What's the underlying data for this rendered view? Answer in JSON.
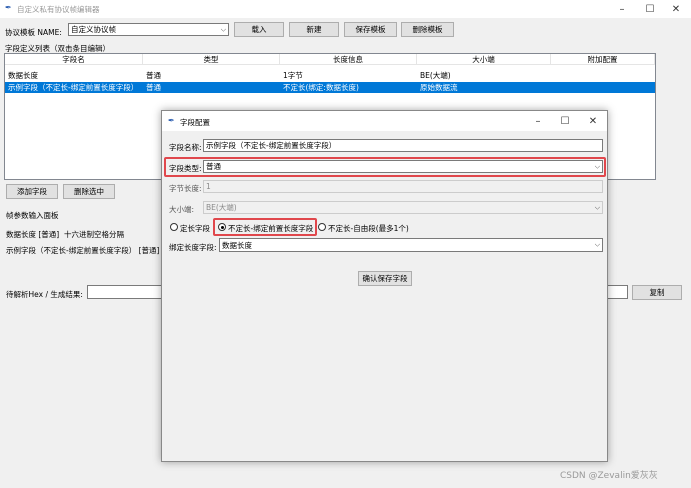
{
  "main": {
    "title": "自定义私有协议帧编辑器",
    "protocol_label": "协议模板 NAME:",
    "protocol_value": "自定义协议帧",
    "buttons": {
      "load": "载入",
      "new": "新建",
      "save": "保存模板",
      "delete": "删除模板"
    },
    "field_list_label": "字段定义列表（双击条目编辑）",
    "table": {
      "headers": [
        "字段名",
        "类型",
        "长度信息",
        "大小端",
        "附加配置"
      ],
      "rows": [
        [
          "数据长度",
          "普通",
          "1字节",
          "BE(大端)",
          ""
        ],
        [
          "示例字段（不定长-绑定前置长度字段）",
          "普通",
          "不定长(绑定:数据长度)",
          "原始数据流",
          ""
        ]
      ]
    },
    "add_field": "添加字段",
    "delete_selected": "删除选中",
    "frame_params_title": "帧参数输入面板",
    "param1_label": "数据长度 [普通]",
    "param1_hint": "十六进制空格分隔",
    "param2_label": "示例字段（不定长-绑定前置长度字段） [普通]",
    "parse_label": "待解析Hex / 生成结果:",
    "copy": "复制"
  },
  "dialog": {
    "title": "字段配置",
    "name_label": "字段名称:",
    "name_value": "示例字段（不定长-绑定前置长度字段）",
    "type_label": "字段类型:",
    "type_value": "普通",
    "byte_len_label": "字节长度:",
    "byte_len_value": "1",
    "endian_label": "大小端:",
    "endian_value": "BE(大端)",
    "radio_fixed": "定长字段",
    "radio_bound": "不定长-绑定前置长度字段",
    "radio_free": "不定长-自由段(最多1个)",
    "bind_label": "绑定长度字段:",
    "bind_value": "数据长度",
    "confirm": "确认保存字段"
  },
  "watermark": "CSDN @Zevalin爱灰灰",
  "colors": {
    "selection": "#0078d7",
    "highlight_box": "#e0474c"
  }
}
